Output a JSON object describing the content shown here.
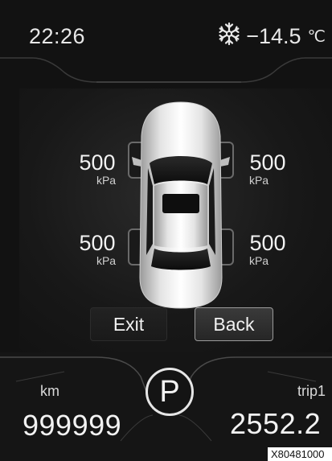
{
  "status": {
    "time": "22:26",
    "temperature": "−14.5",
    "temperature_unit": "℃",
    "icon": "snowflake-icon"
  },
  "tire_pressure": {
    "front_left": {
      "value": "500",
      "unit": "kPa"
    },
    "front_right": {
      "value": "500",
      "unit": "kPa"
    },
    "rear_left": {
      "value": "500",
      "unit": "kPa"
    },
    "rear_right": {
      "value": "500",
      "unit": "kPa"
    }
  },
  "buttons": {
    "exit": "Exit",
    "back": "Back"
  },
  "odometer": {
    "label": "km",
    "value": "999999"
  },
  "trip": {
    "label": "trip1",
    "value": "2552.2"
  },
  "gear": "P",
  "reference_code": "X80481000"
}
